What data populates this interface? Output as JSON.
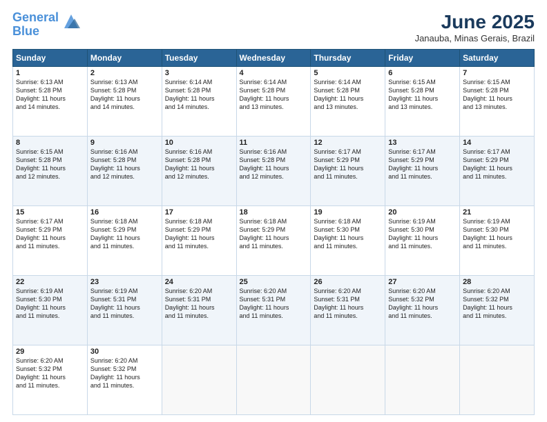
{
  "header": {
    "logo_line1": "General",
    "logo_line2": "Blue",
    "month": "June 2025",
    "location": "Janauba, Minas Gerais, Brazil"
  },
  "days_of_week": [
    "Sunday",
    "Monday",
    "Tuesday",
    "Wednesday",
    "Thursday",
    "Friday",
    "Saturday"
  ],
  "weeks": [
    [
      {
        "day": "1",
        "sunrise": "6:13 AM",
        "sunset": "5:28 PM",
        "daylight": "11 hours and 14 minutes."
      },
      {
        "day": "2",
        "sunrise": "6:13 AM",
        "sunset": "5:28 PM",
        "daylight": "11 hours and 14 minutes."
      },
      {
        "day": "3",
        "sunrise": "6:14 AM",
        "sunset": "5:28 PM",
        "daylight": "11 hours and 14 minutes."
      },
      {
        "day": "4",
        "sunrise": "6:14 AM",
        "sunset": "5:28 PM",
        "daylight": "11 hours and 13 minutes."
      },
      {
        "day": "5",
        "sunrise": "6:14 AM",
        "sunset": "5:28 PM",
        "daylight": "11 hours and 13 minutes."
      },
      {
        "day": "6",
        "sunrise": "6:15 AM",
        "sunset": "5:28 PM",
        "daylight": "11 hours and 13 minutes."
      },
      {
        "day": "7",
        "sunrise": "6:15 AM",
        "sunset": "5:28 PM",
        "daylight": "11 hours and 13 minutes."
      }
    ],
    [
      {
        "day": "8",
        "sunrise": "6:15 AM",
        "sunset": "5:28 PM",
        "daylight": "11 hours and 12 minutes."
      },
      {
        "day": "9",
        "sunrise": "6:16 AM",
        "sunset": "5:28 PM",
        "daylight": "11 hours and 12 minutes."
      },
      {
        "day": "10",
        "sunrise": "6:16 AM",
        "sunset": "5:28 PM",
        "daylight": "11 hours and 12 minutes."
      },
      {
        "day": "11",
        "sunrise": "6:16 AM",
        "sunset": "5:28 PM",
        "daylight": "11 hours and 12 minutes."
      },
      {
        "day": "12",
        "sunrise": "6:17 AM",
        "sunset": "5:29 PM",
        "daylight": "11 hours and 11 minutes."
      },
      {
        "day": "13",
        "sunrise": "6:17 AM",
        "sunset": "5:29 PM",
        "daylight": "11 hours and 11 minutes."
      },
      {
        "day": "14",
        "sunrise": "6:17 AM",
        "sunset": "5:29 PM",
        "daylight": "11 hours and 11 minutes."
      }
    ],
    [
      {
        "day": "15",
        "sunrise": "6:17 AM",
        "sunset": "5:29 PM",
        "daylight": "11 hours and 11 minutes."
      },
      {
        "day": "16",
        "sunrise": "6:18 AM",
        "sunset": "5:29 PM",
        "daylight": "11 hours and 11 minutes."
      },
      {
        "day": "17",
        "sunrise": "6:18 AM",
        "sunset": "5:29 PM",
        "daylight": "11 hours and 11 minutes."
      },
      {
        "day": "18",
        "sunrise": "6:18 AM",
        "sunset": "5:29 PM",
        "daylight": "11 hours and 11 minutes."
      },
      {
        "day": "19",
        "sunrise": "6:18 AM",
        "sunset": "5:30 PM",
        "daylight": "11 hours and 11 minutes."
      },
      {
        "day": "20",
        "sunrise": "6:19 AM",
        "sunset": "5:30 PM",
        "daylight": "11 hours and 11 minutes."
      },
      {
        "day": "21",
        "sunrise": "6:19 AM",
        "sunset": "5:30 PM",
        "daylight": "11 hours and 11 minutes."
      }
    ],
    [
      {
        "day": "22",
        "sunrise": "6:19 AM",
        "sunset": "5:30 PM",
        "daylight": "11 hours and 11 minutes."
      },
      {
        "day": "23",
        "sunrise": "6:19 AM",
        "sunset": "5:31 PM",
        "daylight": "11 hours and 11 minutes."
      },
      {
        "day": "24",
        "sunrise": "6:20 AM",
        "sunset": "5:31 PM",
        "daylight": "11 hours and 11 minutes."
      },
      {
        "day": "25",
        "sunrise": "6:20 AM",
        "sunset": "5:31 PM",
        "daylight": "11 hours and 11 minutes."
      },
      {
        "day": "26",
        "sunrise": "6:20 AM",
        "sunset": "5:31 PM",
        "daylight": "11 hours and 11 minutes."
      },
      {
        "day": "27",
        "sunrise": "6:20 AM",
        "sunset": "5:32 PM",
        "daylight": "11 hours and 11 minutes."
      },
      {
        "day": "28",
        "sunrise": "6:20 AM",
        "sunset": "5:32 PM",
        "daylight": "11 hours and 11 minutes."
      }
    ],
    [
      {
        "day": "29",
        "sunrise": "6:20 AM",
        "sunset": "5:32 PM",
        "daylight": "11 hours and 11 minutes."
      },
      {
        "day": "30",
        "sunrise": "6:20 AM",
        "sunset": "5:32 PM",
        "daylight": "11 hours and 11 minutes."
      },
      null,
      null,
      null,
      null,
      null
    ]
  ],
  "labels": {
    "sunrise": "Sunrise:",
    "sunset": "Sunset:",
    "daylight": "Daylight:"
  }
}
